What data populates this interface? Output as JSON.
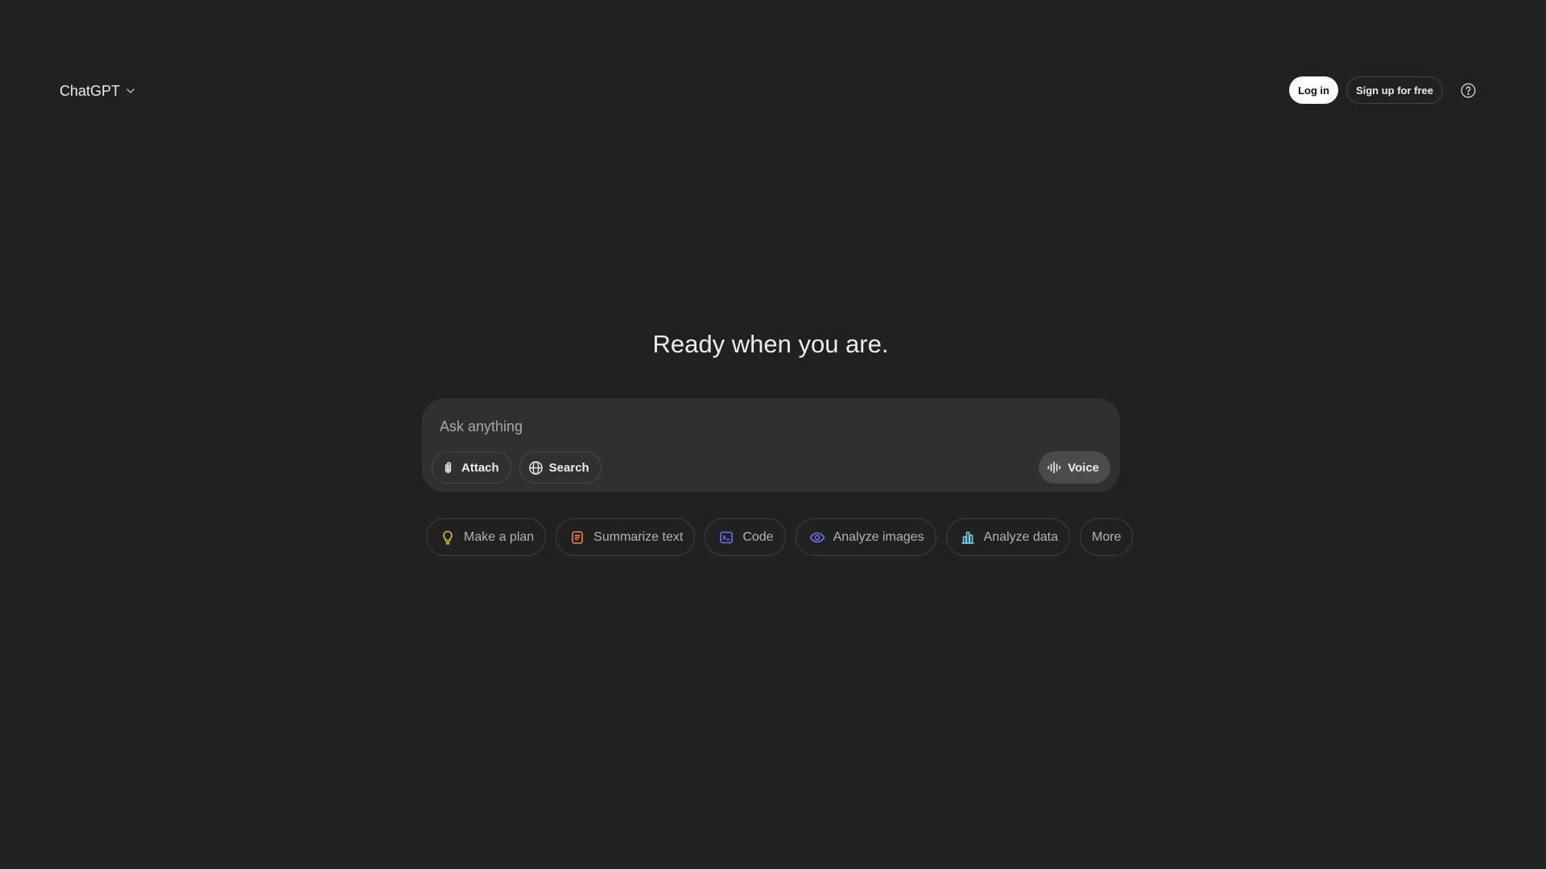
{
  "header": {
    "model_label": "ChatGPT",
    "login_label": "Log in",
    "signup_label": "Sign up for free"
  },
  "main": {
    "headline": "Ready when you are."
  },
  "composer": {
    "placeholder": "Ask anything",
    "value": "",
    "attach_label": "Attach",
    "search_label": "Search",
    "voice_label": "Voice"
  },
  "suggestions": [
    {
      "label": "Make a plan",
      "icon": "lightbulb-icon",
      "color": "#e2c541"
    },
    {
      "label": "Summarize text",
      "icon": "document-icon",
      "color": "#ea8444"
    },
    {
      "label": "Code",
      "icon": "terminal-icon",
      "color": "#6c71ff"
    },
    {
      "label": "Analyze images",
      "icon": "eye-icon",
      "color": "#6c71ff"
    },
    {
      "label": "Analyze data",
      "icon": "bar-chart-icon",
      "color": "#76d0eb"
    },
    {
      "label": "More",
      "icon": "",
      "color": ""
    }
  ],
  "colors": {
    "background": "#212121",
    "composer": "#303030",
    "text": "#ececec"
  }
}
